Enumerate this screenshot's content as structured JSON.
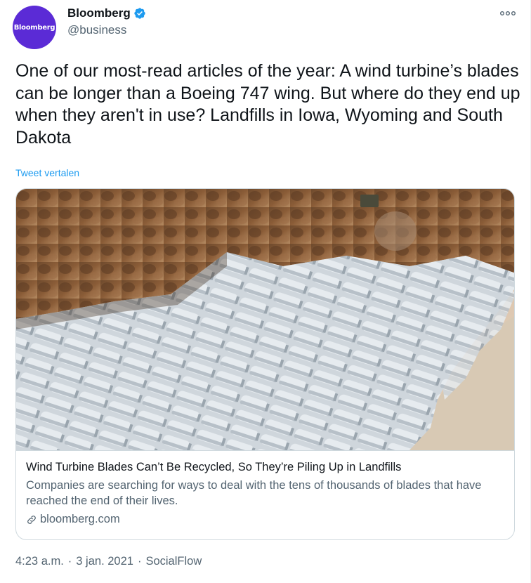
{
  "account": {
    "avatar_text": "Bloomberg",
    "display_name": "Bloomberg",
    "handle": "@business",
    "verified_icon": "verified-badge-icon"
  },
  "tweet": {
    "text": "One of our most-read articles of the year: A wind turbine’s blades can be longer than a Boeing 747 wing. But where do they end up when they aren't in use? Landfills in Iowa, Wyoming and South Dakota",
    "translate_label": "Tweet vertalen"
  },
  "card": {
    "image_icon": "landfill-photo",
    "title": "Wind Turbine Blades Can’t Be Recycled, So They’re Piling Up in Landfills",
    "description": "Companies are searching for ways to deal with the tens of thousands of blades that have reached the end of their lives.",
    "domain": "bloomberg.com"
  },
  "meta": {
    "time": "4:23 a.m.",
    "separator": "·",
    "date": "3 jan. 2021",
    "source": "SocialFlow"
  },
  "colors": {
    "brand_purple": "#5b2bd6",
    "link_blue": "#1d9bf0",
    "secondary_text": "#536471"
  }
}
